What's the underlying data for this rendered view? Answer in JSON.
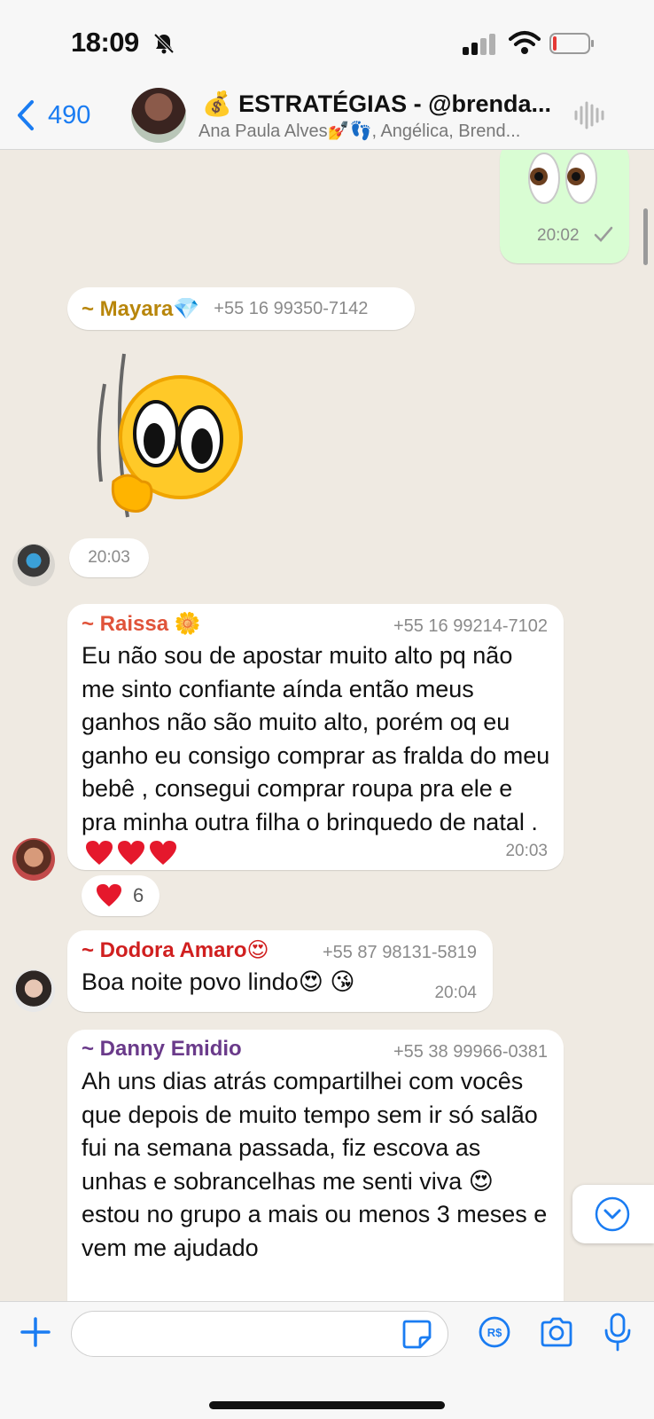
{
  "status_bar": {
    "time": "18:09",
    "icons": [
      "bell-off-icon",
      "signal-icon",
      "wifi-icon",
      "battery-icon"
    ]
  },
  "header": {
    "back_count": "490",
    "group_title": "💰 ESTRATÉGIAS - @brenda...",
    "group_members": "Ana Paula Alves💅👣, Angélica, Brend...",
    "icons": [
      "chevron-left-icon",
      "voice-waveform-icon"
    ]
  },
  "messages": {
    "outgoing": {
      "emoji": "👀",
      "time": "20:02",
      "status_icon": "check-icon"
    },
    "mayara": {
      "sender": "~ Mayara💎",
      "phone": "+55 16 99350-7142",
      "sticker": "peeking-emoji-sticker",
      "time": "20:03"
    },
    "raissa": {
      "sender": "~ Raissa 🌼",
      "phone": "+55 16 99214-7102",
      "text": "Eu não sou de apostar muito alto pq não me sinto confiante aínda então meus ganhos não são muito alto, porém oq eu ganho eu consigo comprar as fralda do meu bebê , consegui comprar roupa pra ele e pra minha outra filha o brinquedo de natal .",
      "time": "20:03",
      "reaction_count": "6"
    },
    "dodora": {
      "sender": "~ Dodora Amaro😍",
      "phone": "+55 87 98131-5819",
      "text": "Boa noite povo lindo😍 😘",
      "time": "20:04"
    },
    "danny": {
      "sender": "~ Danny Emidio",
      "phone": "+55 38 99966-0381",
      "text": "Ah uns dias atrás compartilhei com vocês que depois de muito tempo sem ir só salão fui na semana passada, fiz escova as unhas e sobrancelhas me senti viva 😍 estou no grupo a mais ou menos 3 meses e vem me ajudado"
    }
  },
  "input_bar": {
    "placeholder": "",
    "icons": [
      "plus-icon",
      "sticker-icon",
      "pix-payment-icon",
      "camera-icon",
      "microphone-icon"
    ]
  },
  "colors": {
    "accent": "#1a7cf2",
    "outgoing_bubble": "#d9fdd3",
    "chat_bg": "#efeae2",
    "mayara_name": "#b8860b",
    "raissa_name": "#e0533a",
    "dodora_name": "#d01f1f",
    "danny_name": "#6a3a8a"
  }
}
